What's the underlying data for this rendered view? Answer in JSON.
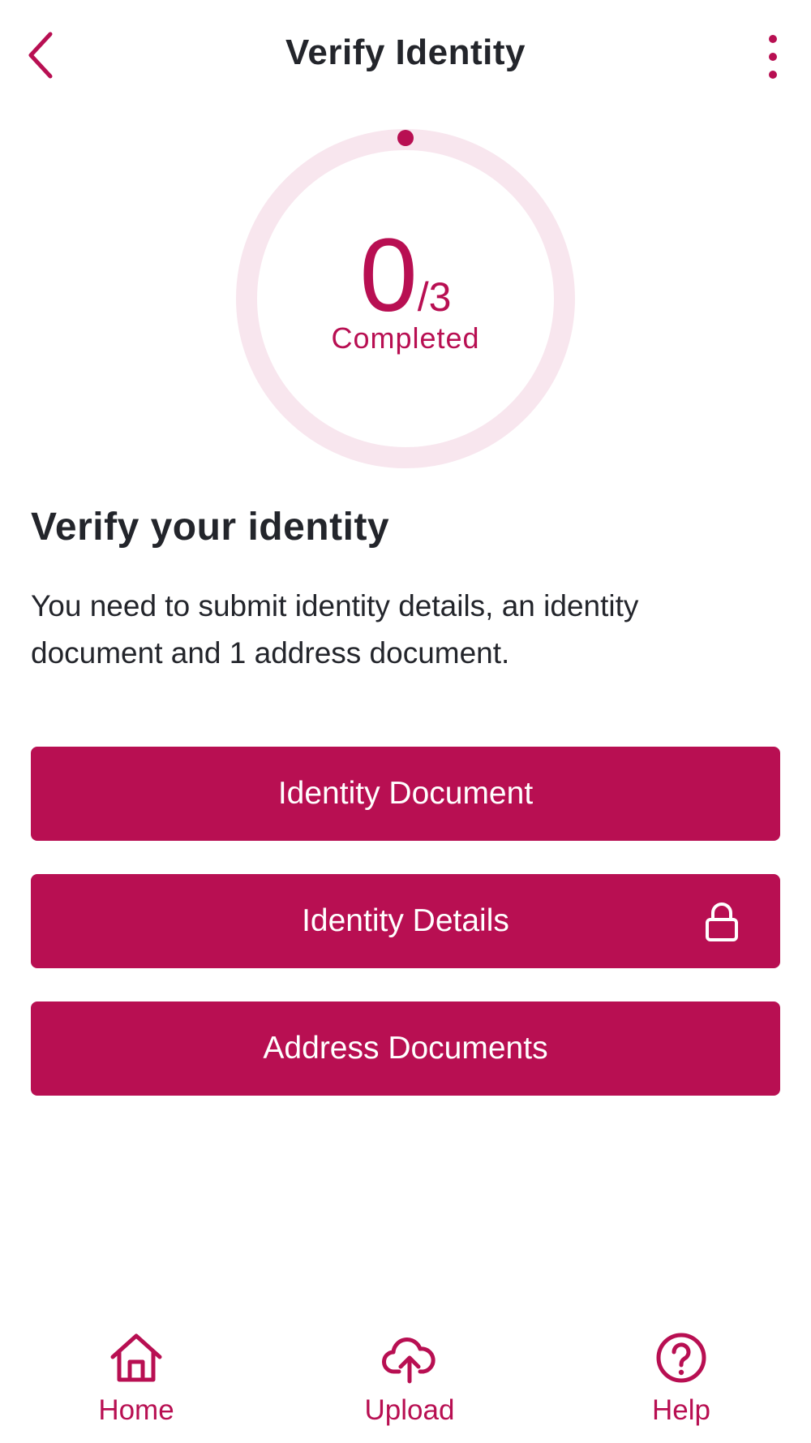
{
  "header": {
    "title": "Verify Identity",
    "back_icon": "chevron-left-icon",
    "more_icon": "more-vertical-icon"
  },
  "progress": {
    "completed": "0",
    "total": "/3",
    "label": "Completed",
    "fraction": 0
  },
  "content": {
    "heading": "Verify your identity",
    "description": "You need to submit identity details, an identity document and 1 address document."
  },
  "actions": [
    {
      "label": "Identity Document"
    },
    {
      "label": "Identity Details",
      "icon": "lock-icon"
    },
    {
      "label": "Address Documents"
    }
  ],
  "nav": [
    {
      "label": "Home",
      "icon": "home-icon"
    },
    {
      "label": "Upload",
      "icon": "cloud-upload-icon"
    },
    {
      "label": "Help",
      "icon": "help-circle-icon"
    }
  ],
  "colors": {
    "accent": "#b80f52",
    "ring_track": "#f8e6ee",
    "text": "#23252b",
    "background": "#ffffff"
  }
}
